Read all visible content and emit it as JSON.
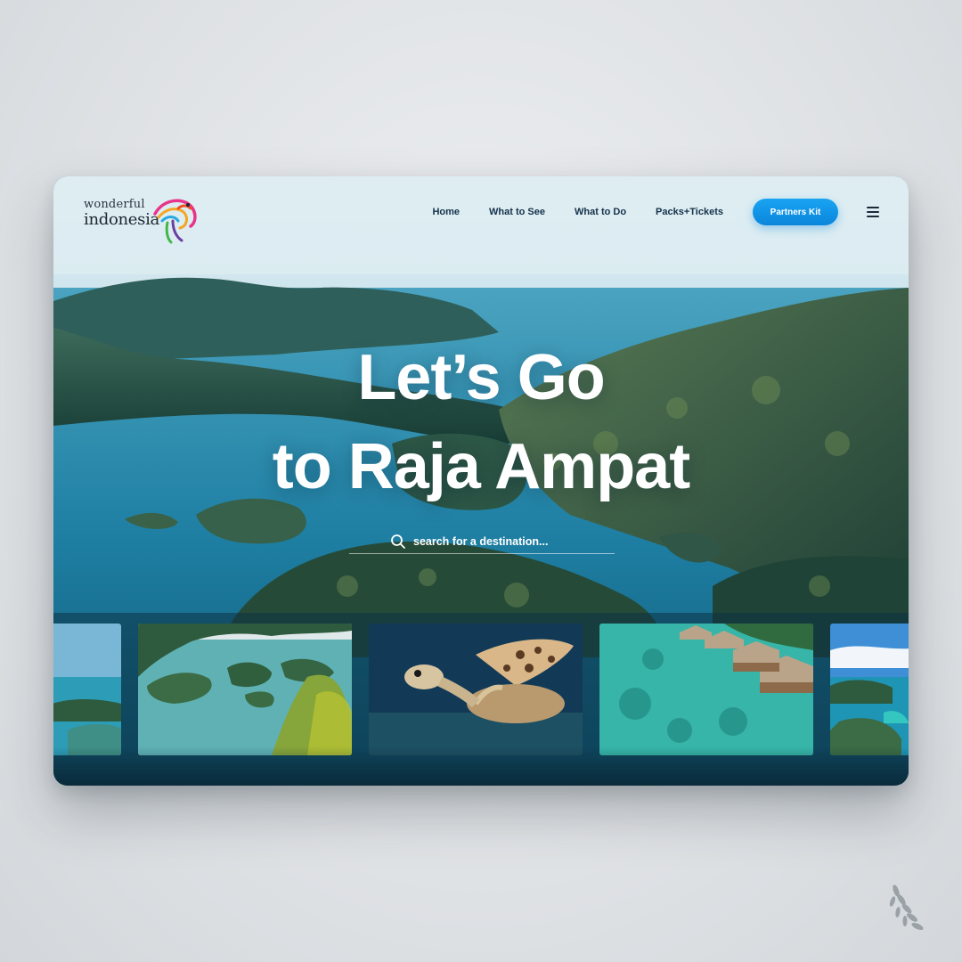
{
  "brand": {
    "logo_line1": "wonderful",
    "logo_line2": "indonesia"
  },
  "nav": {
    "links": [
      "Home",
      "What to See",
      "What to Do",
      "Packs+Tickets"
    ],
    "cta_label": "Partners Kit",
    "menu_icon": "hamburger-menu-icon"
  },
  "hero": {
    "title_line1": "Let’s Go",
    "title_line2": "to Raja Ampat",
    "search_placeholder": "search for a destination..."
  },
  "thumbnails": [
    {
      "name": "lagoon-coast",
      "icon": "photo"
    },
    {
      "name": "karst-islands",
      "icon": "photo"
    },
    {
      "name": "sea-turtle",
      "icon": "photo"
    },
    {
      "name": "stilt-houses",
      "icon": "photo"
    },
    {
      "name": "island-bay",
      "icon": "photo"
    }
  ],
  "colors": {
    "accent": "#0a86db",
    "nav_text": "#15324a",
    "headline": "#ffffff"
  }
}
